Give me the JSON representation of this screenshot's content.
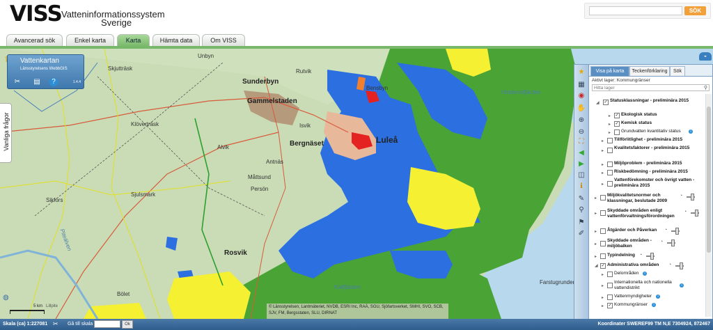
{
  "header": {
    "logo": "VISS",
    "subtitle_line1": "Vatteninformationssystem",
    "subtitle_line2": "Sverige",
    "search_placeholder": "",
    "search_button": "SÖK"
  },
  "tabs": [
    {
      "label": "Avancerad sök"
    },
    {
      "label": "Enkel karta"
    },
    {
      "label": "Karta"
    },
    {
      "label": "Hämta data"
    },
    {
      "label": "Om VISS"
    }
  ],
  "active_tab": "Karta",
  "vattenkartan": {
    "title": "Vattenkartan",
    "subtitle": "Länsstyrelsens WebbGIS",
    "version": "1.4.4"
  },
  "faq_label": "Vanliga frågor",
  "map": {
    "places": [
      "Skjutträsk",
      "Unbyn",
      "Rutvik",
      "Sunderbyn",
      "Gammelstaden",
      "Bensbyn",
      "Isvik",
      "Luleå",
      "Bergnäset",
      "Klöverträsk",
      "Antnäs",
      "Alvik",
      "Måttsund",
      "Sjulsmark",
      "Persön",
      "Sikfors",
      "Piteälven",
      "Rosvik",
      "Bölet",
      "Kallfjärden",
      "Farstugrunden",
      "Hindersöfjärden"
    ],
    "copyright": "© Länsstyrelsen, Lantmäteriet, NVDB, ESRI Inc, RAÄ, SGU, Sjöfartsverket, SMHI, SVO, SCB, SJV, FM, Bergsstaten, SLU, DIRNAT",
    "scale_label": "5 km",
    "lillpite": "Lillpite"
  },
  "panel": {
    "tabs": [
      {
        "label": "Visa på karta"
      },
      {
        "label": "Teckenförklaring"
      },
      {
        "label": "Sök"
      }
    ],
    "active_layer": "Aktivt lager: Kommungränser",
    "search_placeholder": "Hitta lager",
    "tree": [
      {
        "label": "Statusklassningar - preliminära 2015",
        "checked": true,
        "bold": true
      },
      {
        "label": "Ekologisk status",
        "checked": true,
        "bold": true
      },
      {
        "label": "Kemisk status",
        "checked": true,
        "bold": true
      },
      {
        "label": "Grundvatten kvantitativ status",
        "checked": false,
        "bold": false
      },
      {
        "label": "Tillförlitlighet - preliminära 2015",
        "checked": false,
        "bold": true
      },
      {
        "label": "Kvalitetsfaktorer - preliminära 2015",
        "checked": false,
        "bold": true
      },
      {
        "label": "Miljöproblem - preliminära 2015",
        "checked": false,
        "bold": true
      },
      {
        "label": "Riskbedömning - preliminära 2015",
        "checked": false,
        "bold": true
      },
      {
        "label": "Vattenförekomster och övrigt vatten - preliminära 2015",
        "checked": false,
        "bold": true
      },
      {
        "label": "Miljökvalitetsnormer och klassningar, beslutade 2009",
        "checked": false,
        "bold": true
      },
      {
        "label": "Skyddade områden enligt vattenförvaltningsförordningen",
        "checked": false,
        "bold": true
      },
      {
        "label": "Åtgärder och Påverkan",
        "checked": false,
        "bold": true
      },
      {
        "label": "Skyddade områden - miljöbalken",
        "checked": false,
        "bold": true
      },
      {
        "label": "Typindelning",
        "checked": false,
        "bold": true
      },
      {
        "label": "Administrativa områden",
        "checked": true,
        "bold": true
      },
      {
        "label": "Delområden",
        "checked": false,
        "bold": false
      },
      {
        "label": "Internationella och nationella vattendistrikt",
        "checked": false,
        "bold": false
      },
      {
        "label": "Vattenmyndigheter",
        "checked": false,
        "bold": false
      },
      {
        "label": "Kommungränser",
        "checked": true,
        "bold": false
      }
    ]
  },
  "status_bar": {
    "scale": "Skala (ca) 1:227081",
    "goto_label": "Gå till skala",
    "ok": "Ok",
    "coordinates": "Koordinater SWEREF99 TM N,E 7304924, 872467"
  },
  "colors": {
    "accent_green": "#78b86a",
    "status_blue": "#2b6fe0",
    "status_yellow": "#f5f032",
    "status_green": "#4aa335",
    "status_red": "#e52222",
    "search_orange": "#f2a03a"
  }
}
